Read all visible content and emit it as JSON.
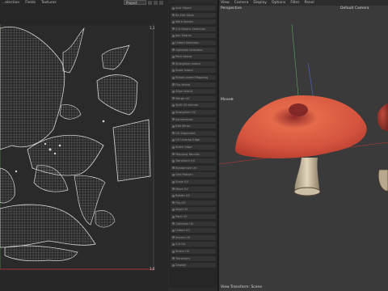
{
  "menubar": {
    "items": [
      "...election",
      "Fields",
      "Textures"
    ]
  },
  "uv_panel": {
    "dropdown_value": "Project",
    "corner_top": "1,1",
    "corner_bottom": "1,0"
  },
  "toolbar": {
    "buttons": [
      "Add Object",
      "Re-Edit Mesh",
      "Mark Seams",
      "Cut Seams Selection",
      "Join Seams",
      "Unfold Selection",
      "Optimize Selection",
      "Pack Island",
      "Straighten Island",
      "Scale Island",
      "Rotate Island Mapping",
      "Flip Island",
      "Align Island",
      "Merge UV",
      "Split UV Islands",
      "Straighten UV",
      "Symmetrize",
      "Edit Mirror",
      "UV Alignment",
      "UV Unwrap Edge",
      "Stitch Edge",
      "Mapping Bounds",
      "Transform UV",
      "Randomize UV",
      "Grid Pattern",
      "Scale UV",
      "Move UV",
      "Rotate UV",
      "Flip UV",
      "Align UV",
      "Pack UV",
      "Optimize UV",
      "Unfold UV",
      "Seams UV",
      "Cut UV",
      "Select UV",
      "Transform",
      "Display"
    ]
  },
  "viewport": {
    "menu": [
      "View",
      "Camera",
      "Display",
      "Options",
      "Filter",
      "Panel"
    ],
    "camera_name": "Perspective",
    "camera_mode": "Default Camera",
    "move_label": "Move",
    "status": "View Transform: Scene"
  },
  "colors": {
    "cap": "#d4543e",
    "stem": "#c8b89a",
    "uv_wire": "#bdbdbd",
    "accent_red": "#c4392f"
  },
  "icons": [
    "dropdown-chevron-icon",
    "uv-toggle-icon",
    "move-gizmo-icon"
  ]
}
